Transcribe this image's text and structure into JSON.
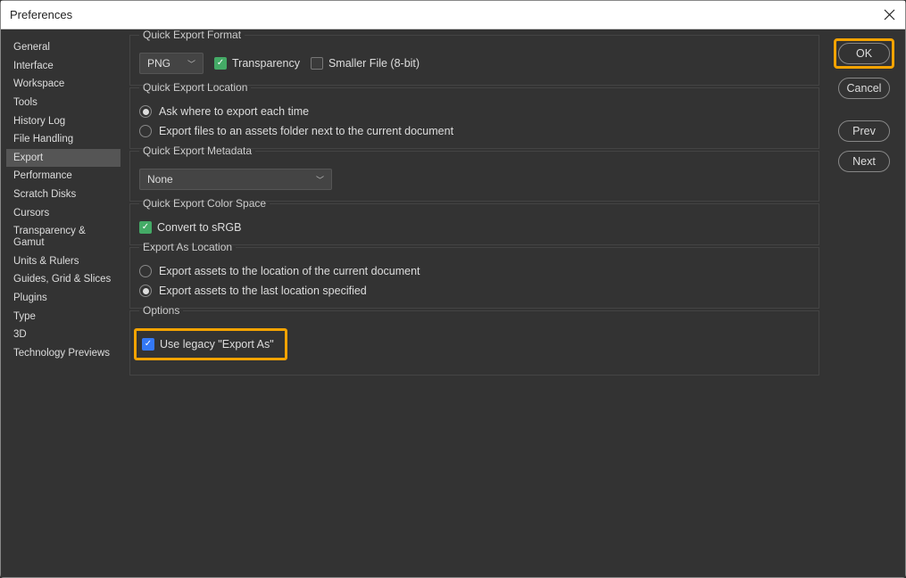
{
  "window": {
    "title": "Preferences"
  },
  "sidebar": {
    "items": [
      {
        "label": "General"
      },
      {
        "label": "Interface"
      },
      {
        "label": "Workspace"
      },
      {
        "label": "Tools"
      },
      {
        "label": "History Log"
      },
      {
        "label": "File Handling"
      },
      {
        "label": "Export"
      },
      {
        "label": "Performance"
      },
      {
        "label": "Scratch Disks"
      },
      {
        "label": "Cursors"
      },
      {
        "label": "Transparency & Gamut"
      },
      {
        "label": "Units & Rulers"
      },
      {
        "label": "Guides, Grid & Slices"
      },
      {
        "label": "Plugins"
      },
      {
        "label": "Type"
      },
      {
        "label": "3D"
      },
      {
        "label": "Technology Previews"
      }
    ],
    "selected_index": 6
  },
  "main": {
    "format": {
      "legend": "Quick Export Format",
      "select_value": "PNG",
      "transparency_label": "Transparency",
      "transparency_checked": true,
      "smaller_label": "Smaller File (8-bit)",
      "smaller_checked": false
    },
    "location": {
      "legend": "Quick Export Location",
      "opt1": "Ask where to export each time",
      "opt2": "Export files to an assets folder next to the current document",
      "selected": 0
    },
    "metadata": {
      "legend": "Quick Export Metadata",
      "select_value": "None"
    },
    "colorspace": {
      "legend": "Quick Export Color Space",
      "convert_label": "Convert to sRGB",
      "convert_checked": true
    },
    "exportas": {
      "legend": "Export As Location",
      "opt1": "Export assets to the location of the current document",
      "opt2": "Export assets to the last location specified",
      "selected": 1
    },
    "options": {
      "legend": "Options",
      "legacy_label": "Use legacy \"Export As\"",
      "legacy_checked": true
    }
  },
  "buttons": {
    "ok": "OK",
    "cancel": "Cancel",
    "prev": "Prev",
    "next": "Next"
  }
}
